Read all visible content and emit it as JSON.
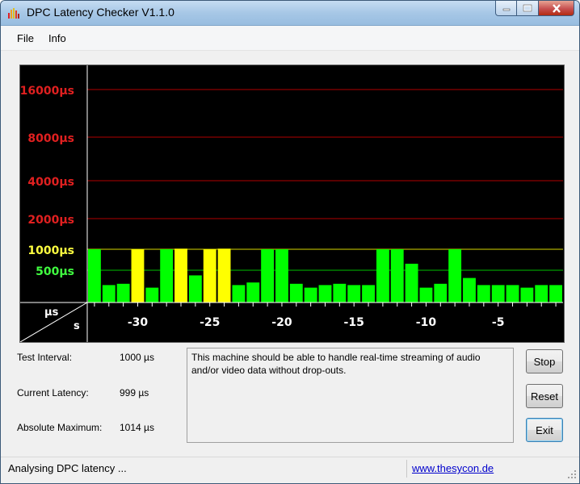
{
  "window": {
    "title": "DPC Latency Checker V1.1.0"
  },
  "menu": {
    "items": [
      "File",
      "Info"
    ]
  },
  "graph": {
    "y_tick_labels": [
      "16000µs",
      "8000µs",
      "4000µs",
      "2000µs",
      "1000µs",
      "500µs"
    ],
    "y_tick_colors": [
      "#e02020",
      "#e02020",
      "#e02020",
      "#e02020",
      "#ffff40",
      "#40ff40"
    ],
    "x_tick_labels": [
      "-30",
      "-25",
      "-20",
      "-15",
      "-10",
      "-5"
    ],
    "corner_unit_y": "µs",
    "corner_unit_x": "s",
    "colors": {
      "grid_red": "#b00000",
      "grid_yellow": "#d8d800",
      "grid_green": "#00c000",
      "bar_green": "#00ff00",
      "bar_yellow": "#ffff00",
      "axis": "#ffffff"
    }
  },
  "chart_data": {
    "type": "bar",
    "x": [
      -33,
      -32,
      -31,
      -30,
      -29,
      -28,
      -27,
      -26,
      -25,
      -24,
      -23,
      -22,
      -21,
      -20,
      -19,
      -18,
      -17,
      -16,
      -15,
      -14,
      -13,
      -12,
      -11,
      -10,
      -9,
      -8,
      -7,
      -6,
      -5,
      -4,
      -3,
      -2,
      -1
    ],
    "values": [
      1000,
      270,
      290,
      1000,
      230,
      1000,
      1014,
      420,
      1000,
      1014,
      270,
      310,
      1000,
      1000,
      290,
      230,
      270,
      290,
      270,
      270,
      1000,
      1000,
      620,
      230,
      290,
      1000,
      380,
      270,
      270,
      270,
      230,
      270,
      270
    ],
    "bar_colors": [
      "green",
      "green",
      "green",
      "yellow",
      "green",
      "green",
      "yellow",
      "green",
      "yellow",
      "yellow",
      "green",
      "green",
      "green",
      "green",
      "green",
      "green",
      "green",
      "green",
      "green",
      "green",
      "green",
      "green",
      "green",
      "green",
      "green",
      "green",
      "green",
      "green",
      "green",
      "green",
      "green",
      "green",
      "green"
    ],
    "y_scale": "log",
    "xlabel": "s",
    "ylabel": "µs"
  },
  "info": {
    "test_interval_label": "Test Interval:",
    "test_interval_value": "1000 µs",
    "current_latency_label": "Current Latency:",
    "current_latency_value": "999 µs",
    "absolute_max_label": "Absolute Maximum:",
    "absolute_max_value": "1014 µs"
  },
  "message": "This machine should be able to handle real-time streaming of audio and/or video data without drop-outs.",
  "buttons": {
    "stop": "Stop",
    "reset": "Reset",
    "exit": "Exit"
  },
  "status": {
    "text": "Analysing DPC latency ...",
    "link": "www.thesycon.de"
  }
}
